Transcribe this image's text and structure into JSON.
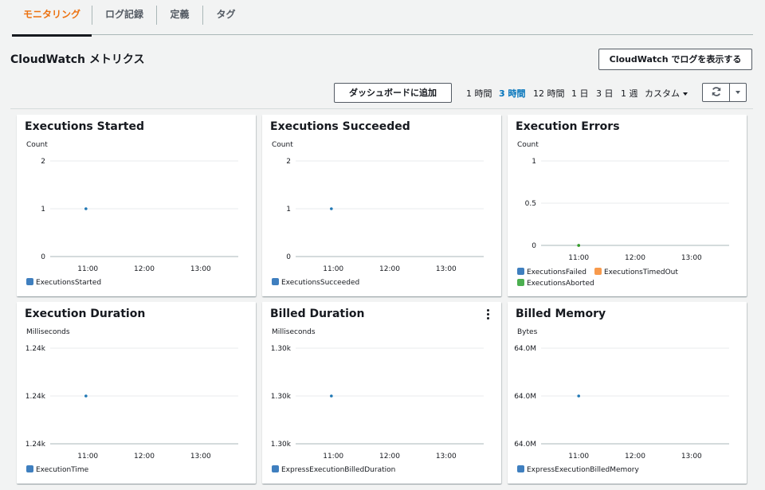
{
  "tabs": [
    {
      "label": "モニタリング",
      "active": true
    },
    {
      "label": "ログ記録",
      "active": false
    },
    {
      "label": "定義",
      "active": false
    },
    {
      "label": "タグ",
      "active": false
    }
  ],
  "header": {
    "title": "CloudWatch メトリクス",
    "logs_button": "CloudWatch でログを表示する",
    "dashboard_button": "ダッシュボードに追加",
    "ranges": [
      "1 時間",
      "3 時間",
      "12 時間",
      "1 日",
      "3 日",
      "1 週",
      "カスタム"
    ],
    "selected_range": "3 時間",
    "refresh_icon": "refresh-icon",
    "accent_color": "#ec7211",
    "link_color": "#0073bb"
  },
  "chart_data": [
    {
      "type": "line",
      "title": "Executions Started",
      "ylabel": "Count",
      "yticks": [
        "2",
        "1",
        "0"
      ],
      "ylim": [
        0,
        2
      ],
      "xticks": [
        "11:00",
        "12:00",
        "13:00"
      ],
      "series": [
        {
          "name": "ExecutionsStarted",
          "color": "#1f77b4",
          "points": [
            {
              "x": "10:58",
              "y": 1
            }
          ]
        }
      ]
    },
    {
      "type": "line",
      "title": "Executions Succeeded",
      "ylabel": "Count",
      "yticks": [
        "2",
        "1",
        "0"
      ],
      "ylim": [
        0,
        2
      ],
      "xticks": [
        "11:00",
        "12:00",
        "13:00"
      ],
      "series": [
        {
          "name": "ExecutionsSucceeded",
          "color": "#1f77b4",
          "points": [
            {
              "x": "10:58",
              "y": 1
            }
          ]
        }
      ]
    },
    {
      "type": "line",
      "title": "Execution Errors",
      "ylabel": "Count",
      "yticks": [
        "1",
        "0.5",
        "0"
      ],
      "ylim": [
        0,
        1
      ],
      "xticks": [
        "11:00",
        "12:00",
        "13:00"
      ],
      "series": [
        {
          "name": "ExecutionsFailed",
          "color": "#1f77b4",
          "points": [
            {
              "x": "11:00",
              "y": 0
            }
          ]
        },
        {
          "name": "ExecutionsTimedOut",
          "color": "#ff7f0e",
          "points": [
            {
              "x": "11:00",
              "y": 0
            }
          ]
        },
        {
          "name": "ExecutionsAborted",
          "color": "#2ca02c",
          "points": [
            {
              "x": "11:00",
              "y": 0
            }
          ]
        }
      ]
    },
    {
      "type": "line",
      "title": "Execution Duration",
      "ylabel": "Milliseconds",
      "yticks": [
        "1.24k",
        "1.24k",
        "1.24k"
      ],
      "ylim": [
        1240,
        1240
      ],
      "xticks": [
        "11:00",
        "12:00",
        "13:00"
      ],
      "series": [
        {
          "name": "ExecutionTime",
          "color": "#1f77b4",
          "points": [
            {
              "x": "10:58",
              "y": 1240
            }
          ]
        }
      ]
    },
    {
      "type": "line",
      "title": "Billed Duration",
      "ylabel": "Milliseconds",
      "yticks": [
        "1.30k",
        "1.30k",
        "1.30k"
      ],
      "ylim": [
        1300,
        1300
      ],
      "xticks": [
        "11:00",
        "12:00",
        "13:00"
      ],
      "has_menu": true,
      "series": [
        {
          "name": "ExpressExecutionBilledDuration",
          "color": "#1f77b4",
          "points": [
            {
              "x": "10:58",
              "y": 1300
            }
          ]
        }
      ]
    },
    {
      "type": "line",
      "title": "Billed Memory",
      "ylabel": "Bytes",
      "yticks": [
        "64.0M",
        "64.0M",
        "64.0M"
      ],
      "ylim": [
        64000000,
        64000000
      ],
      "xticks": [
        "11:00",
        "12:00",
        "13:00"
      ],
      "series": [
        {
          "name": "ExpressExecutionBilledMemory",
          "color": "#1f77b4",
          "points": [
            {
              "x": "11:00",
              "y": 64000000
            }
          ]
        }
      ]
    }
  ]
}
